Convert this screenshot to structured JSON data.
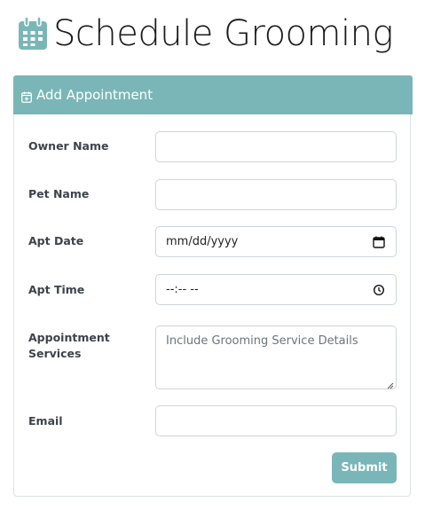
{
  "page": {
    "title": "Schedule Grooming",
    "title_icon": "calendar-icon"
  },
  "colors": {
    "accent": "#7ab6b8",
    "title_icon": "#7ab6b8"
  },
  "card": {
    "header_icon": "calendar-plus-icon",
    "header_label": "Add Appointment"
  },
  "form": {
    "owner_name": {
      "label": "Owner Name",
      "value": ""
    },
    "pet_name": {
      "label": "Pet Name",
      "value": ""
    },
    "apt_date": {
      "label": "Apt Date",
      "value": "mm/dd/yyyy",
      "icon": "calendar-icon"
    },
    "apt_time": {
      "label": "Apt Time",
      "value": "--:-- --",
      "icon": "clock-icon"
    },
    "services": {
      "label": "Appointment Services",
      "placeholder": "Include Grooming Service Details"
    },
    "email": {
      "label": "Email",
      "value": ""
    },
    "submit_label": "Submit"
  }
}
